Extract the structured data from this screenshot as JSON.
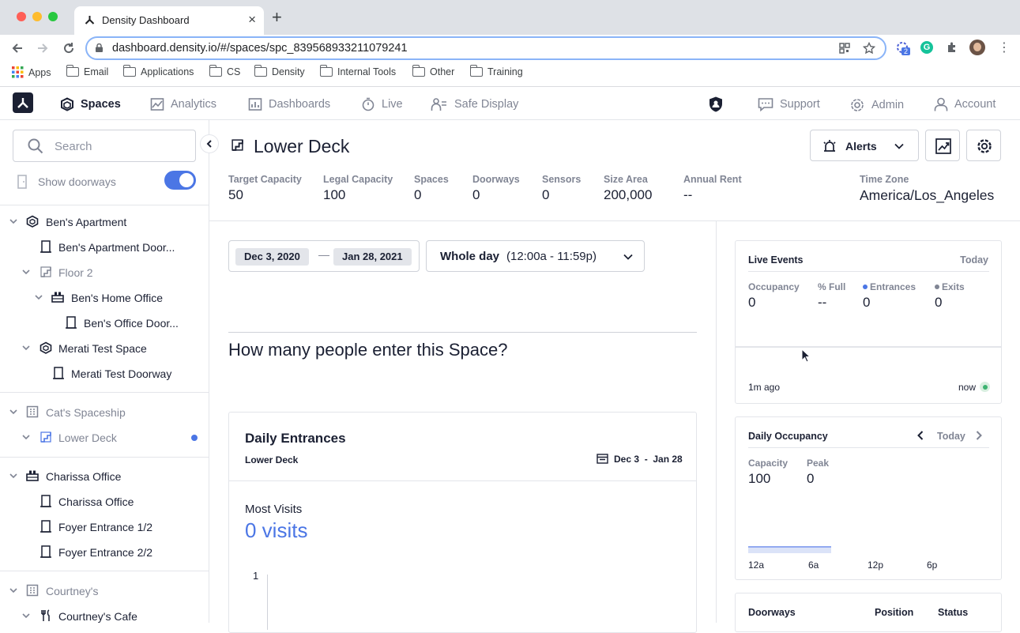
{
  "browser": {
    "tab_title": "Density Dashboard",
    "url": "dashboard.density.io/#/spaces/spc_839568933211079241",
    "extension_badge": "2",
    "bookmarks": [
      {
        "label": "Apps",
        "icon": "apps-grid-icon"
      },
      {
        "label": "Email",
        "icon": "folder-icon"
      },
      {
        "label": "Applications",
        "icon": "folder-icon"
      },
      {
        "label": "CS",
        "icon": "folder-icon"
      },
      {
        "label": "Density",
        "icon": "folder-icon"
      },
      {
        "label": "Internal Tools",
        "icon": "folder-icon"
      },
      {
        "label": "Other",
        "icon": "folder-icon"
      },
      {
        "label": "Training",
        "icon": "folder-icon"
      }
    ]
  },
  "nav": {
    "items": [
      {
        "label": "Spaces",
        "icon": "spaces-icon",
        "active": true
      },
      {
        "label": "Analytics",
        "icon": "analytics-icon"
      },
      {
        "label": "Dashboards",
        "icon": "dashboards-icon"
      },
      {
        "label": "Live",
        "icon": "stopwatch-icon"
      },
      {
        "label": "Safe Display",
        "icon": "safe-display-icon"
      }
    ],
    "right": [
      {
        "label": "Support",
        "icon": "chat-icon"
      },
      {
        "label": "Admin",
        "icon": "gear-icon"
      },
      {
        "label": "Account",
        "icon": "user-icon"
      }
    ]
  },
  "sidebar": {
    "search_placeholder": "Search",
    "show_doorways_label": "Show doorways",
    "show_doorways_on": true,
    "tree": [
      {
        "label": "Ben's Apartment",
        "icon": "building-icon"
      },
      {
        "label": "Ben's Apartment Door...",
        "icon": "doorway-icon"
      },
      {
        "label": "Floor 2",
        "icon": "floor-icon"
      },
      {
        "label": "Ben's Home Office",
        "icon": "desk-icon"
      },
      {
        "label": "Ben's Office Door...",
        "icon": "doorway-icon"
      },
      {
        "label": "Merati Test Space",
        "icon": "space-icon"
      },
      {
        "label": "Merati Test Doorway",
        "icon": "doorway-icon"
      },
      {
        "label": "Cat's Spaceship",
        "icon": "campus-icon"
      },
      {
        "label": "Lower Deck",
        "icon": "floor-icon"
      },
      {
        "label": "Charissa Office",
        "icon": "desk-icon"
      },
      {
        "label": "Charissa Office",
        "icon": "doorway-icon"
      },
      {
        "label": "Foyer Entrance 1/2",
        "icon": "doorway-icon"
      },
      {
        "label": "Foyer Entrance 2/2",
        "icon": "doorway-icon"
      },
      {
        "label": "Courtney's",
        "icon": "campus-icon"
      },
      {
        "label": "Courtney's Cafe",
        "icon": "cafe-icon"
      }
    ]
  },
  "space": {
    "title": "Lower Deck",
    "alerts_label": "Alerts",
    "stats": [
      {
        "label": "Target Capacity",
        "value": "50"
      },
      {
        "label": "Legal Capacity",
        "value": "100"
      },
      {
        "label": "Spaces",
        "value": "0"
      },
      {
        "label": "Doorways",
        "value": "0"
      },
      {
        "label": "Sensors",
        "value": "0"
      },
      {
        "label": "Size Area",
        "value": "200,000"
      },
      {
        "label": "Annual Rent",
        "value": "--"
      },
      {
        "label": "Time Zone",
        "value": "America/Los_Angeles"
      }
    ]
  },
  "filters": {
    "start_date": "Dec 3, 2020",
    "date_separator": "—",
    "end_date": "Jan 28, 2021",
    "time_range_label": "Whole day",
    "time_range_detail": "(12:00a - 11:59p)"
  },
  "report": {
    "question": "How many people enter this Space?",
    "card_title": "Daily Entrances",
    "card_subtitle": "Lower Deck",
    "card_date_range": "Dec 3  -  Jan 28",
    "most_visits_label": "Most Visits",
    "most_visits_value": "0 visits",
    "y_tick": "1"
  },
  "live_events": {
    "title": "Live Events",
    "period": "Today",
    "metrics": [
      {
        "label": "Occupancy",
        "value": "0"
      },
      {
        "label": "% Full",
        "value": "--"
      },
      {
        "label": "Entrances",
        "value": "0",
        "dot": "#4b76e5"
      },
      {
        "label": "Exits",
        "value": "0",
        "dot": "#808594"
      }
    ],
    "axis_start": "1m ago",
    "axis_end": "now"
  },
  "daily_occupancy": {
    "title": "Daily Occupancy",
    "period": "Today",
    "metrics": [
      {
        "label": "Capacity",
        "value": "100"
      },
      {
        "label": "Peak",
        "value": "0"
      }
    ],
    "x_ticks": [
      "12a",
      "6a",
      "12p",
      "6p"
    ]
  },
  "doorways_table": {
    "headers": [
      "Doorways",
      "Position",
      "Status"
    ]
  },
  "colors": {
    "accent": "#4b76e5",
    "text": "#1b2033",
    "muted": "#808594",
    "live_green": "#3cb371"
  }
}
